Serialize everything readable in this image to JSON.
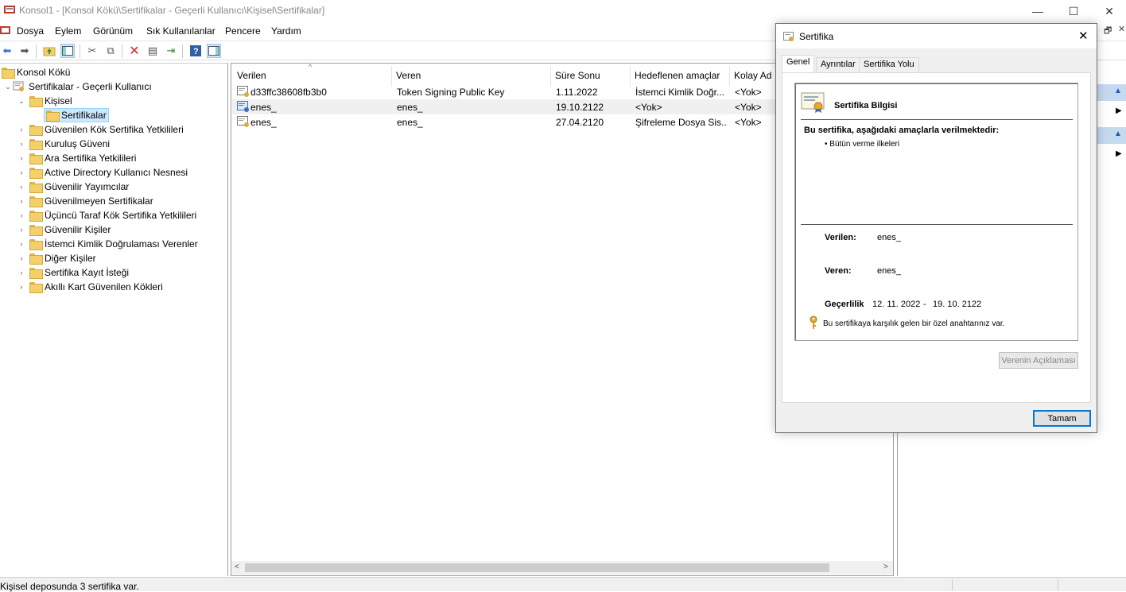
{
  "window": {
    "title": "Konsol1 - [Konsol Kökü\\Sertifikalar - Geçerli Kullanıcı\\Kişisel\\Sertifikalar]",
    "minimize": "—",
    "maximize": "☐",
    "close": "✕"
  },
  "menu": [
    "Dosya",
    "Eylem",
    "Görünüm",
    "Sık Kullanılanlar",
    "Pencere",
    "Yardım"
  ],
  "tree": {
    "root": "Konsol Kökü",
    "store": "Sertifikalar - Geçerli Kullanıcı",
    "personal": "Kişisel",
    "certificates": "Sertifikalar",
    "folders": [
      "Güvenilen Kök Sertifika Yetkilileri",
      "Kuruluş Güveni",
      "Ara Sertifika Yetkilileri",
      "Active Directory Kullanıcı Nesnesi",
      "Güvenilir Yayımcılar",
      "Güvenilmeyen Sertifikalar",
      "Üçüncü Taraf Kök Sertifika Yetkilileri",
      "Güvenilir Kişiler",
      "İstemci Kimlik Doğrulaması Verenler",
      "Diğer Kişiler",
      "Sertifika Kayıt İsteği",
      "Akıllı Kart Güvenilen Kökleri"
    ]
  },
  "list": {
    "columns": [
      "Verilen",
      "Veren",
      "Süre Sonu",
      "Hedeflenen amaçlar",
      "Kolay Ad"
    ],
    "rows": [
      [
        "d33ffc38608fb3b0",
        "Token Signing Public Key",
        "1.11.2022",
        "İstemci Kimlik Doğr...",
        "<Yok>"
      ],
      [
        "enes_",
        "enes_",
        "19.10.2122",
        "<Yok>",
        "<Yok>"
      ],
      [
        "enes_",
        "enes_",
        "27.04.2120",
        "Şifreleme Dosya Sis...",
        "<Yok>"
      ]
    ]
  },
  "status": "Kişisel deposunda 3 sertifika var.",
  "dialog": {
    "title": "Sertifika",
    "tabs": [
      "Genel",
      "Ayrıntılar",
      "Sertifika Yolu"
    ],
    "info_title": "Sertifika Bilgisi",
    "purpose_heading": "Bu sertifika, aşağıdaki amaçlarla verilmektedir:",
    "purpose_item": "• Bütün verme ilkeleri",
    "issued_to_label": "Verilen:",
    "issued_to_value": "enes_",
    "issued_by_label": "Veren:",
    "issued_by_value": "enes_",
    "validity_label": "Geçerlilik",
    "validity_from": "12. 11. 2022",
    "validity_sep": "-",
    "validity_to": "19. 10. 2122",
    "private_key_note": "Bu sertifikaya karşılık gelen bir özel anahtarınız var.",
    "issuer_statement_button": "Verenin Açıklaması",
    "ok_button": "Tamam",
    "close": "✕"
  },
  "colors": {
    "accent": "#0078d7",
    "selection": "#cce8ff",
    "actions_header": "#c5d9ef"
  }
}
